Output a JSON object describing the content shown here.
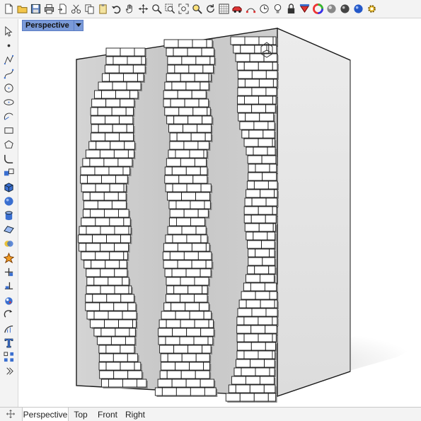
{
  "toolbar": {
    "icons": [
      "new-document",
      "open-folder",
      "save",
      "print",
      "import",
      "cut",
      "copy",
      "paste",
      "undo",
      "pan-hand",
      "move",
      "zoom-in",
      "zoom-window",
      "zoom-extents",
      "zoom-selected",
      "rotate-view",
      "grid-viewport",
      "car-render",
      "select-points",
      "ortho-snap",
      "light-bulb",
      "lock",
      "layer-color",
      "color-wheel",
      "render-sphere",
      "shaded-sphere",
      "material-sphere",
      "options-gear"
    ]
  },
  "left_toolbar": {
    "icons": [
      "select-arrow",
      "point",
      "polyline",
      "curve",
      "circle",
      "ellipse",
      "arc",
      "rectangle",
      "polygon",
      "fillet",
      "transform",
      "solid-box",
      "sphere",
      "cylinder",
      "surface",
      "boolean",
      "explode",
      "trim",
      "split",
      "solid-tools",
      "rotate",
      "analyze",
      "text",
      "array",
      "expand-chevron"
    ]
  },
  "viewport": {
    "label": "Perspective",
    "dropdown_icon": "triangle-down-icon",
    "gumball_icon": "world-axes-icon"
  },
  "tabs": [
    "Perspective",
    "Top",
    "Front",
    "Right"
  ],
  "colors": {
    "accent": "#7a9ad8",
    "wall": "#c9c9c9",
    "brick": "#ffffff",
    "edge": "#1a1a1a"
  }
}
